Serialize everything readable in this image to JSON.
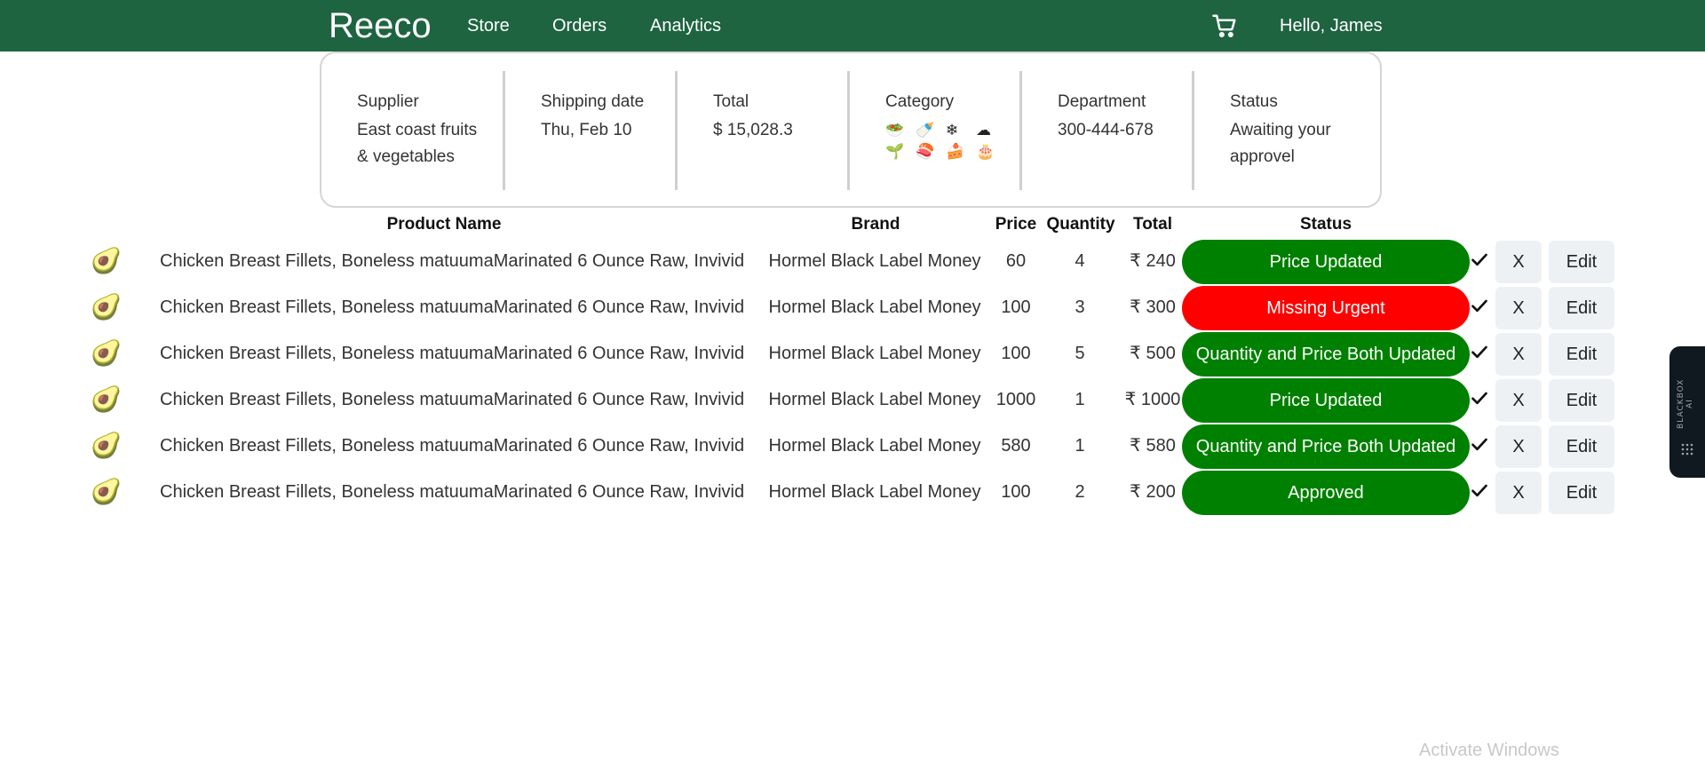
{
  "nav": {
    "brand": "Reeco",
    "links": [
      "Store",
      "Orders",
      "Analytics"
    ],
    "greeting": "Hello, James"
  },
  "summary": {
    "supplier": {
      "label": "Supplier",
      "value": "East coast fruits & vegetables"
    },
    "shipping": {
      "label": "Shipping date",
      "value": "Thu, Feb 10"
    },
    "total": {
      "label": "Total",
      "value": "$ 15,028.3"
    },
    "category": {
      "label": "Category",
      "icons": [
        "🥗",
        "🍼",
        "❄",
        "☁",
        "🌱",
        "🍣",
        "🍰",
        "🎂"
      ]
    },
    "department": {
      "label": "Department",
      "value": "300-444-678"
    },
    "status": {
      "label": "Status",
      "value": "Awaiting your approvel"
    }
  },
  "table": {
    "headers": {
      "product": "Product Name",
      "brand": "Brand",
      "price": "Price",
      "quantity": "Quantity",
      "total": "Total",
      "status": "Status"
    },
    "rows": [
      {
        "icon": "🥑",
        "product": "Chicken Breast Fillets, Boneless matuumaMarinated 6 Ounce Raw, Invivid",
        "brand": "Hormel Black Label Money",
        "price": "60",
        "quantity": "4",
        "total": "₹ 240",
        "status": "Price Updated",
        "status_color": "#008000",
        "reject_label": "X",
        "edit_label": "Edit"
      },
      {
        "icon": "🥑",
        "product": "Chicken Breast Fillets, Boneless matuumaMarinated 6 Ounce Raw, Invivid",
        "brand": "Hormel Black Label Money",
        "price": "100",
        "quantity": "3",
        "total": "₹ 300",
        "status": "Missing Urgent",
        "status_color": "#ff0000",
        "reject_label": "X",
        "edit_label": "Edit"
      },
      {
        "icon": "🥑",
        "product": "Chicken Breast Fillets, Boneless matuumaMarinated 6 Ounce Raw, Invivid",
        "brand": "Hormel Black Label Money",
        "price": "100",
        "quantity": "5",
        "total": "₹ 500",
        "status": "Quantity and Price Both Updated",
        "status_color": "#008000",
        "reject_label": "X",
        "edit_label": "Edit"
      },
      {
        "icon": "🥑",
        "product": "Chicken Breast Fillets, Boneless matuumaMarinated 6 Ounce Raw, Invivid",
        "brand": "Hormel Black Label Money",
        "price": "1000",
        "quantity": "1",
        "total": "₹ 1000",
        "status": "Price Updated",
        "status_color": "#008000",
        "reject_label": "X",
        "edit_label": "Edit"
      },
      {
        "icon": "🥑",
        "product": "Chicken Breast Fillets, Boneless matuumaMarinated 6 Ounce Raw, Invivid",
        "brand": "Hormel Black Label Money",
        "price": "580",
        "quantity": "1",
        "total": "₹ 580",
        "status": "Quantity and Price Both Updated",
        "status_color": "#008000",
        "reject_label": "X",
        "edit_label": "Edit"
      },
      {
        "icon": "🥑",
        "product": "Chicken Breast Fillets, Boneless matuumaMarinated 6 Ounce Raw, Invivid",
        "brand": "Hormel Black Label Money",
        "price": "100",
        "quantity": "2",
        "total": "₹ 200",
        "status": "Approved",
        "status_color": "#008000",
        "reject_label": "X",
        "edit_label": "Edit"
      }
    ]
  },
  "side_widget": {
    "label": "BLACKBOX AI"
  },
  "watermark": "Activate Windows",
  "colors": {
    "navbar": "#1e6441",
    "approved_green": "#008000",
    "urgent_red": "#ff0000"
  }
}
